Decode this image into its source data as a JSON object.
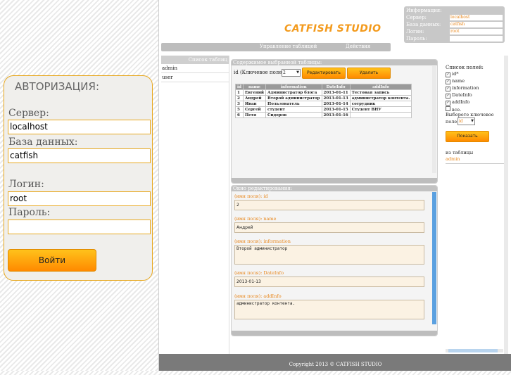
{
  "login": {
    "title": "АВТОРИЗАЦИЯ:",
    "server_label": "Сервер:",
    "server_value": "localhost",
    "db_label": "База данных:",
    "db_value": "catfish",
    "login_label": "Логин:",
    "login_value": "root",
    "password_label": "Пароль:",
    "password_value": "",
    "submit_label": "Войти"
  },
  "header": {
    "logo": "CATFISH STUDIO",
    "info": {
      "title": "Информация:",
      "server_label": "Сервер:",
      "server": "localhost",
      "db_label": "База данных:",
      "db": "catfish",
      "login_label": "Логин:",
      "login": "root",
      "password_label": "Пароль:",
      "password": ""
    }
  },
  "menu": {
    "item1": "Управление таблицей",
    "item2": "Действия"
  },
  "tables": {
    "header": "Список таблиц",
    "items": [
      "admin",
      "user"
    ]
  },
  "content": {
    "title": "Содержимое выбранной таблицы:",
    "key_label": "id (Ключевое поле)",
    "key_select": "2",
    "edit_button": "Редактировать",
    "delete_button": "Удалить",
    "columns": [
      "id",
      "name",
      "information",
      "DateInfo",
      "addInfo"
    ],
    "rows": [
      [
        "1",
        "Евгений",
        "Администратор блога",
        "2013-01-11",
        "Тестовая запись"
      ],
      [
        "2",
        "Андрей",
        "Второй администратор",
        "2013-01-13",
        "администратор контента."
      ],
      [
        "3",
        "Иван",
        "Пользователь",
        "2013-01-14",
        "сотрудник"
      ],
      [
        "5",
        "Сергей",
        "студент",
        "2013-01-15",
        "Студент ВНУ"
      ],
      [
        "6",
        "Петя",
        "Сидоров",
        "2013-01-16",
        ""
      ]
    ]
  },
  "editor": {
    "title": "Окно редактирования:",
    "fields": [
      {
        "label": "(имя поля): id",
        "value": "2"
      },
      {
        "label": "(имя поля): name",
        "value": "Андрей"
      },
      {
        "label": "(имя поля): information",
        "value": "Второй администратор"
      },
      {
        "label": "(имя поля): DateInfo",
        "value": "2013-01-13"
      },
      {
        "label": "(имя поля): addInfo",
        "value": "администратор контента."
      }
    ]
  },
  "fields_panel": {
    "title": "Список полей:",
    "items": [
      "id*",
      "name",
      "information",
      "DateInfo",
      "addInfo",
      "все."
    ],
    "checked": [
      true,
      true,
      true,
      true,
      true,
      false
    ],
    "key_label_1": "Выберете ключевое",
    "key_label_2": "поле",
    "key_select": "id",
    "show_button": "Показать",
    "from_table_label": "из таблицы",
    "from_table_value": "admin"
  },
  "footer": {
    "text": "Copyright 2013 © CATFISH STUDIO"
  },
  "colors": {
    "accent": "#ff9a00",
    "border": "#e8a81e",
    "gray": "#c2c2c2"
  }
}
